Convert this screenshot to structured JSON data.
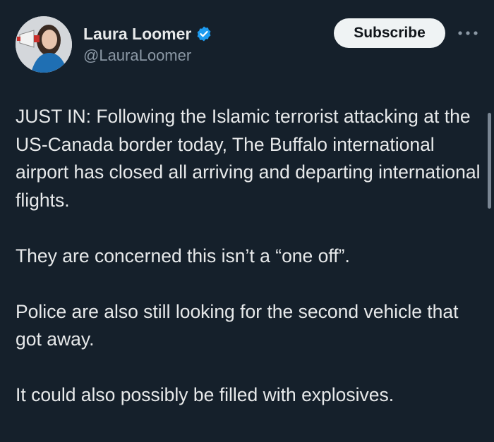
{
  "author": {
    "display_name": "Laura Loomer",
    "handle": "@LauraLoomer",
    "verified": true,
    "verified_color": "#1d9bf0"
  },
  "actions": {
    "subscribe_label": "Subscribe",
    "more_icon": "more-horizontal-icon"
  },
  "post": {
    "paragraphs": [
      "JUST IN: Following the Islamic terrorist attacking at the US-Canada border today, The Buffalo international airport has closed all arriving and departing international flights.",
      "They are concerned this isn’t a “one off”.",
      "Police are also still looking for the second vehicle that got away.",
      "It could also possibly be filled with explosives."
    ]
  },
  "theme": {
    "background": "#15202b",
    "text_primary": "#e7e9ea",
    "text_secondary": "#8b98a5",
    "button_bg": "#eff3f4"
  }
}
